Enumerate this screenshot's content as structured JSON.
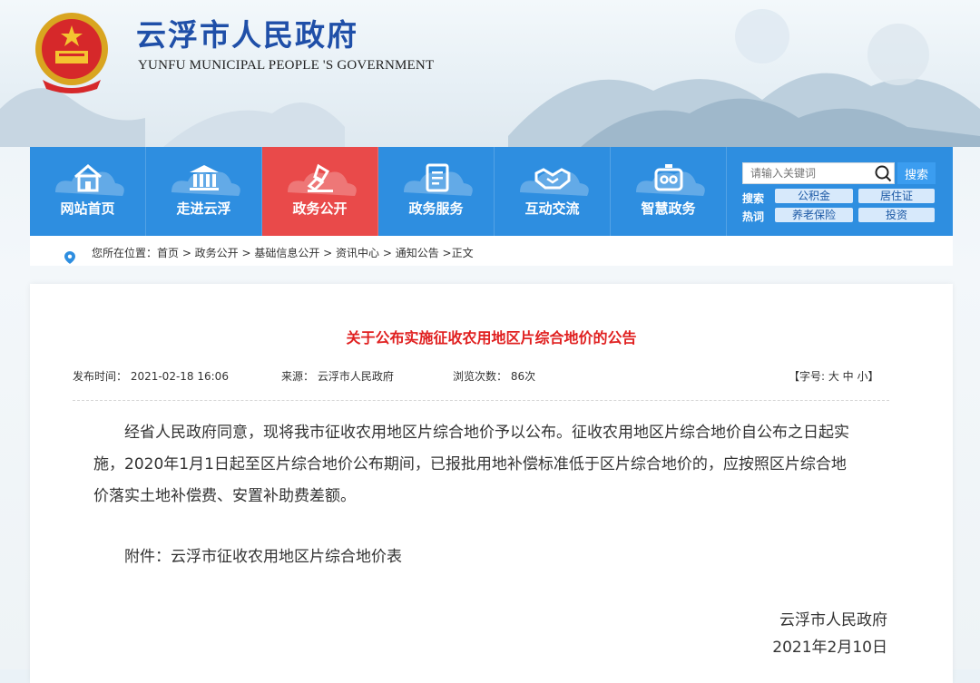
{
  "header": {
    "title": "云浮市人民政府",
    "subtitle": "YUNFU MUNICIPAL PEOPLE 'S GOVERNMENT"
  },
  "nav": {
    "items": [
      {
        "label": "网站首页",
        "icon": "home-icon"
      },
      {
        "label": "走进云浮",
        "icon": "building-icon"
      },
      {
        "label": "政务公开",
        "icon": "stamp-icon"
      },
      {
        "label": "政务服务",
        "icon": "document-icon"
      },
      {
        "label": "互动交流",
        "icon": "handshake-icon"
      },
      {
        "label": "智慧政务",
        "icon": "robot-icon"
      }
    ],
    "active_index": 2
  },
  "search": {
    "placeholder": "请输入关键词",
    "button": "搜索",
    "hot_label_1": "搜索",
    "hot_label_2": "热词",
    "hot_terms": [
      "公积金",
      "居住证",
      "养老保险",
      "投资"
    ]
  },
  "breadcrumb": {
    "text": "您所在位置：首页 > 政务公开 > 基础信息公开 > 资讯中心 > 通知公告 >正文"
  },
  "article": {
    "title": "关于公布实施征收农用地区片综合地价的公告",
    "publish_time": "发布时间： 2021-02-18 16:06",
    "source": "来源： 云浮市人民政府",
    "views": "浏览次数： 86次",
    "font_size": "【字号:  大  中  小】",
    "paragraph1_line1": "经省人民政府同意，现将我市征收农用地区片综合地价予以公布。征收农用地区片综合地价自公布之日起实",
    "paragraph1_line2": "施，2020年1月1日起至区片综合地价公布期间，已报批用地补偿标准低于区片综合地价的，应按照区片综合地",
    "paragraph1_line3": "价落实土地补偿费、安置补助费差额。",
    "attachment": "附件：云浮市征收农用地区片综合地价表",
    "signature": "云浮市人民政府",
    "date": "2021年2月10日"
  },
  "colors": {
    "nav_blue": "#2e8ee0",
    "nav_active_red": "#e94a4a",
    "title_red": "#e02020",
    "brand_blue": "#1f4fa8"
  }
}
